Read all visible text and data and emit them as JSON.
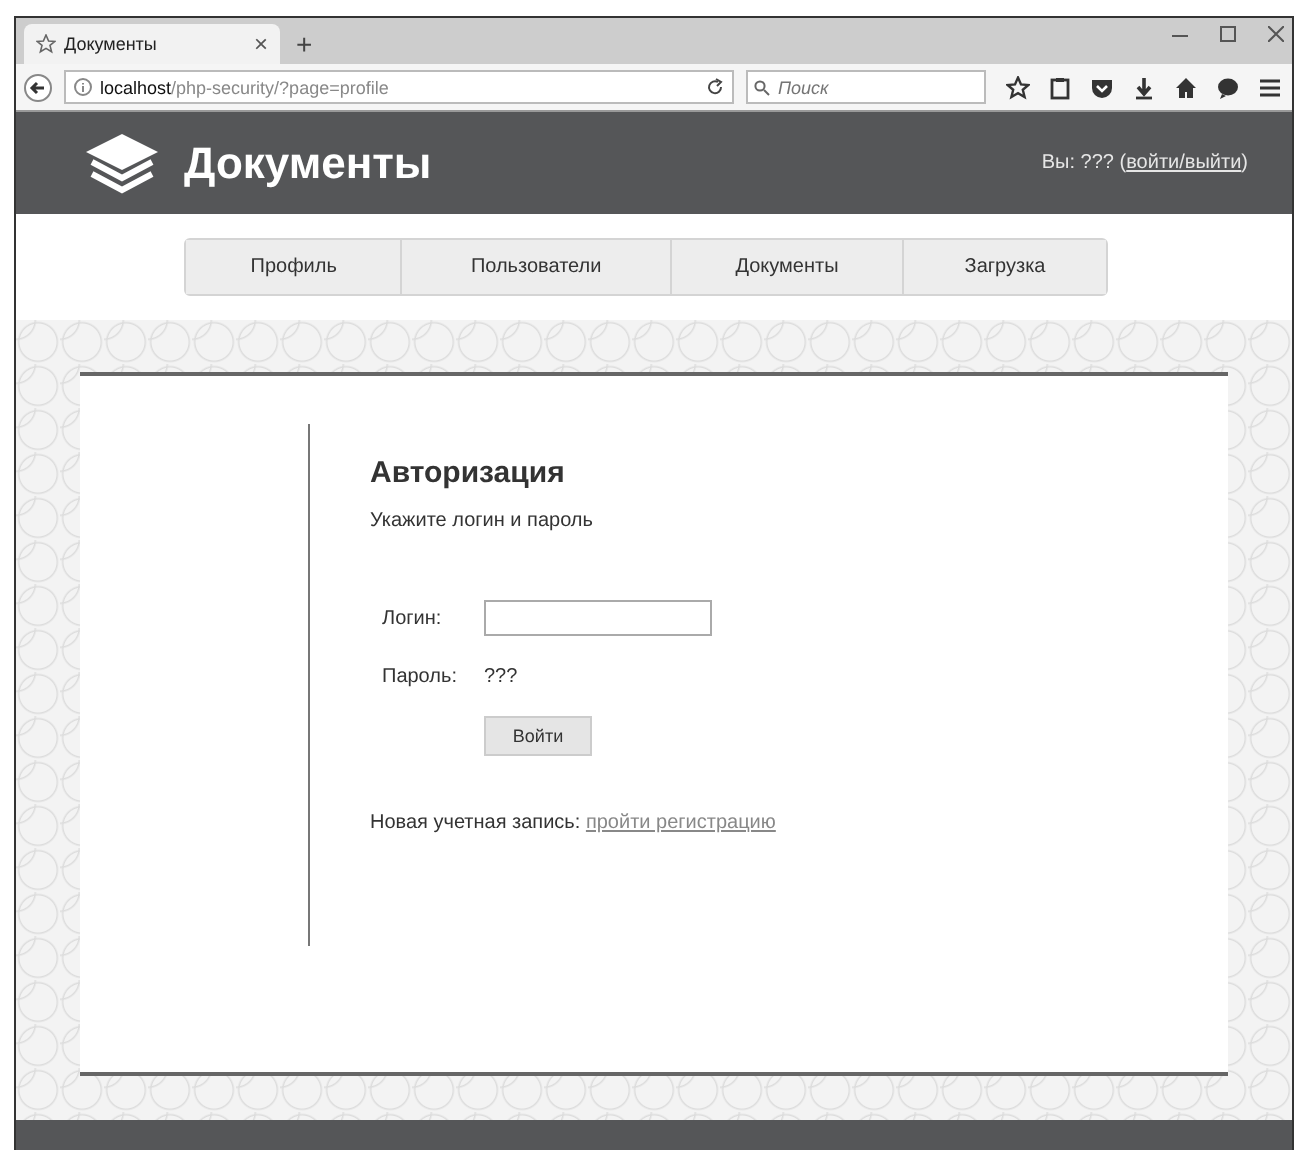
{
  "browser": {
    "tab_title": "Документы",
    "close_glyph": "×",
    "new_tab_glyph": "+",
    "url_host": "localhost",
    "url_path": "/php-security/?page=profile",
    "search_placeholder": "Поиск"
  },
  "header": {
    "title": "Документы",
    "user_prefix": "Вы: ??? (",
    "user_link": "войти/выйти",
    "user_suffix": ")"
  },
  "nav": [
    {
      "label": "Профиль",
      "selected": false
    },
    {
      "label": "Пользователи",
      "selected": false
    },
    {
      "label": "Документы",
      "selected": false
    },
    {
      "label": "Загрузка",
      "selected": false
    }
  ],
  "login": {
    "heading": "Авторизация",
    "subtitle": "Укажите логин и пароль",
    "fields": [
      {
        "kind": "input",
        "label": "Логин:"
      },
      {
        "kind": "text",
        "label": "Пароль:",
        "value": "???"
      }
    ],
    "button": "Войти",
    "register_prefix": "Новая учетная запись:",
    "register_link": "пройти регистрацию"
  }
}
